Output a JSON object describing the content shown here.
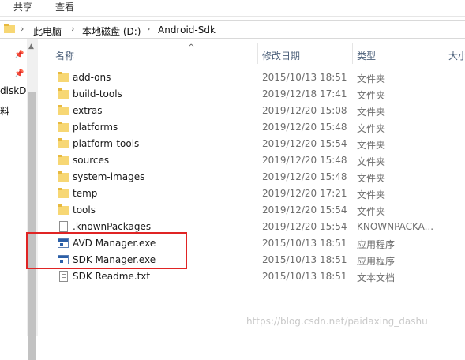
{
  "ribbon": {
    "tabs": [
      "共享",
      "查看"
    ]
  },
  "address": {
    "crumbs": [
      "此电脑",
      "本地磁盘 (D:)",
      "Android-Sdk"
    ]
  },
  "nav": {
    "partial_items": [
      "diskD",
      "料"
    ]
  },
  "columns": {
    "name": "名称",
    "date": "修改日期",
    "type": "类型",
    "size": "大小"
  },
  "files": [
    {
      "name": "add-ons",
      "date": "2015/10/13 18:51",
      "type": "文件夹",
      "icon": "folder-icon"
    },
    {
      "name": "build-tools",
      "date": "2019/12/18 17:41",
      "type": "文件夹",
      "icon": "folder-icon"
    },
    {
      "name": "extras",
      "date": "2019/12/20 15:08",
      "type": "文件夹",
      "icon": "folder-icon"
    },
    {
      "name": "platforms",
      "date": "2019/12/20 15:48",
      "type": "文件夹",
      "icon": "folder-icon"
    },
    {
      "name": "platform-tools",
      "date": "2019/12/20 15:54",
      "type": "文件夹",
      "icon": "folder-icon"
    },
    {
      "name": "sources",
      "date": "2019/12/20 15:48",
      "type": "文件夹",
      "icon": "folder-icon"
    },
    {
      "name": "system-images",
      "date": "2019/12/20 15:48",
      "type": "文件夹",
      "icon": "folder-icon"
    },
    {
      "name": "temp",
      "date": "2019/12/20 17:21",
      "type": "文件夹",
      "icon": "folder-icon"
    },
    {
      "name": "tools",
      "date": "2019/12/20 15:54",
      "type": "文件夹",
      "icon": "folder-icon"
    },
    {
      "name": ".knownPackages",
      "date": "2019/12/20 15:54",
      "type": "KNOWNPACKA...",
      "icon": "file-icon"
    },
    {
      "name": "AVD Manager.exe",
      "date": "2015/10/13 18:51",
      "type": "应用程序",
      "icon": "exe-icon"
    },
    {
      "name": "SDK Manager.exe",
      "date": "2015/10/13 18:51",
      "type": "应用程序",
      "icon": "exe-icon"
    },
    {
      "name": "SDK Readme.txt",
      "date": "2015/10/13 18:51",
      "type": "文本文档",
      "icon": "text-file-icon"
    }
  ],
  "watermark": "https://blog.csdn.net/paidaxing_dashu",
  "colors": {
    "highlight": "#e02424",
    "folder": "#f7d774",
    "header_text": "#4c607a"
  }
}
